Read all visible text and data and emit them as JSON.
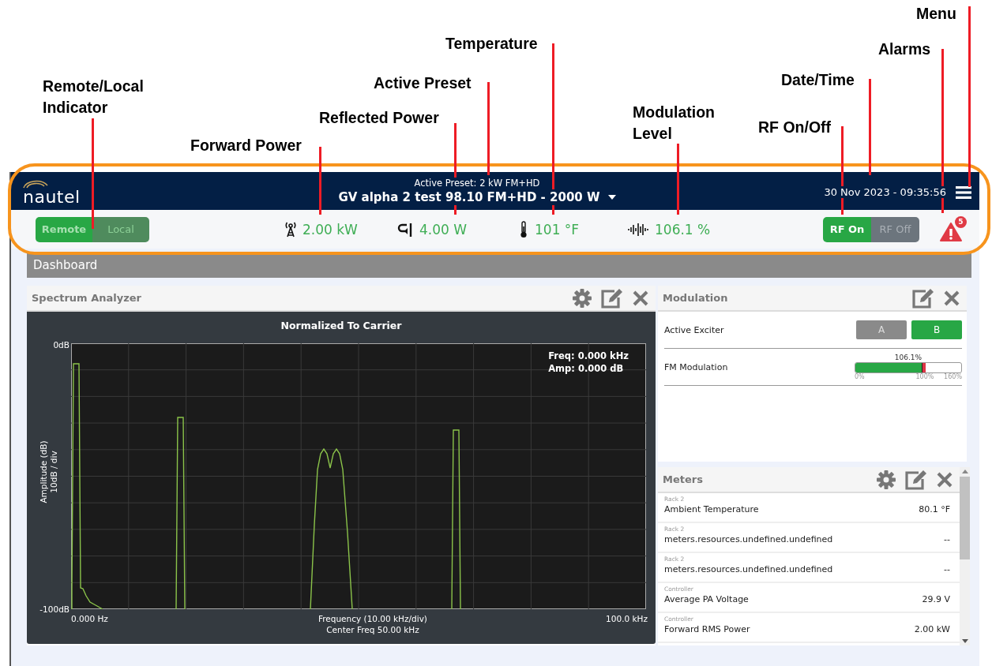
{
  "callouts": [
    {
      "label": "Menu"
    },
    {
      "label": "Temperature"
    },
    {
      "label": "Alarms"
    },
    {
      "label": "Active Preset"
    },
    {
      "label": "Date/Time"
    },
    {
      "label": "Remote/Local Indicator"
    },
    {
      "label": "Reflected Power"
    },
    {
      "label": "Modulation Level"
    },
    {
      "label": "RF On/Off"
    },
    {
      "label": "Forward Power"
    }
  ],
  "header": {
    "logo": "nautel",
    "preset_caption": "Active Preset: 2 kW FM+HD",
    "preset_name": "GV alpha 2 test 98.10 FM+HD - 2000 W",
    "datetime": "30 Nov 2023 - 09:35:56"
  },
  "control_mode": [
    {
      "label": "Remote",
      "selected": true
    },
    {
      "label": "Local",
      "selected": false
    }
  ],
  "readings": [
    {
      "kind": "forward_power",
      "value": "2.00 kW"
    },
    {
      "kind": "reflected_power",
      "value": "4.00 W"
    },
    {
      "kind": "temperature",
      "value": "101 °F"
    },
    {
      "kind": "modulation",
      "value": "106.1 %"
    }
  ],
  "rf": [
    {
      "label": "RF On",
      "selected": true
    },
    {
      "label": "RF Off",
      "selected": false
    }
  ],
  "alarms": {
    "count": "5"
  },
  "dashboard": {
    "title": "Dashboard"
  },
  "spectrum": {
    "title": "Spectrum Analyzer",
    "chart_title": "Normalized To Carrier",
    "cursor": [
      "Freq: 0.000 kHz",
      "Amp: 0.000 dB"
    ],
    "y_top": "0dB",
    "y_bottom": "-100dB",
    "y_label": [
      "Amplitude (dB)",
      "10dB / div"
    ],
    "x_left": "0.000 Hz",
    "x_center": [
      "Frequency (10.00 kHz/div)",
      "Center Freq 50.00 kHz"
    ],
    "x_right": "100.0 kHz"
  },
  "modulation": {
    "title": "Modulation",
    "exciter": {
      "label": "Active Exciter",
      "options": [
        {
          "label": "A",
          "selected": false
        },
        {
          "label": "B",
          "selected": true
        }
      ]
    },
    "fm": {
      "label": "FM Modulation",
      "reading": "106.1%",
      "level": 0.663,
      "scale": [
        "0%",
        "100%",
        "160%"
      ]
    }
  },
  "meters": {
    "title": "Meters",
    "rows": [
      {
        "group": "Rack 2",
        "name": "Ambient Temperature",
        "value": "80.1 °F"
      },
      {
        "group": "Rack 2",
        "name": "meters.resources.undefined.undefined",
        "value": "--"
      },
      {
        "group": "Rack 2",
        "name": "meters.resources.undefined.undefined",
        "value": "--"
      },
      {
        "group": "Controller",
        "name": "Average PA Voltage",
        "value": "29.9 V"
      },
      {
        "group": "Controller",
        "name": "Forward RMS Power",
        "value": "2.00 kW"
      }
    ]
  }
}
